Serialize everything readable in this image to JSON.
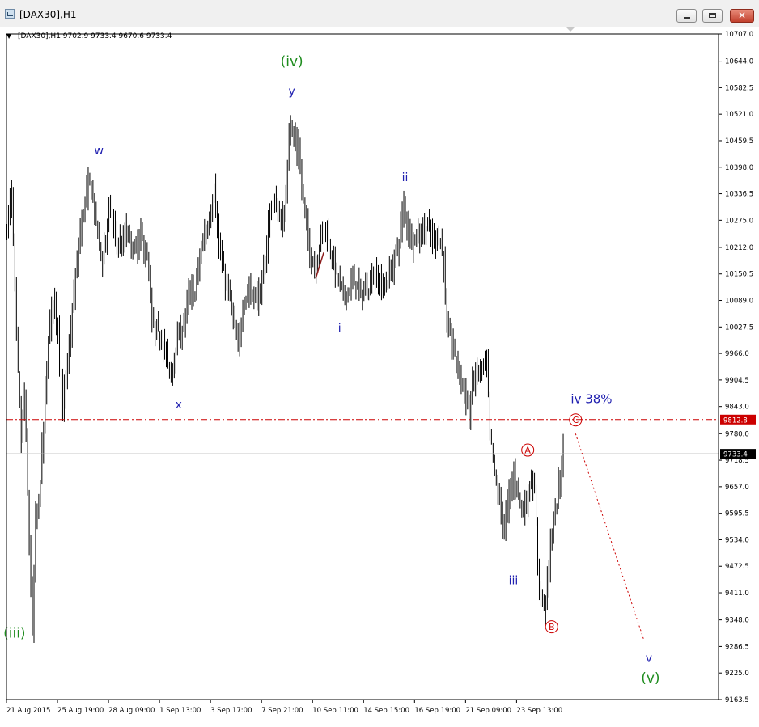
{
  "window": {
    "title": "[DAX30],H1",
    "minimize_glyph": "—",
    "maximize_glyph": "□",
    "close_glyph": "✕"
  },
  "chart_data": {
    "type": "candlestick-bar",
    "symbol_line": "[DAX30],H1  9702.9 9733.4 9670.6 9733.4",
    "header_arrow": "▼",
    "ylim": [
      9163.5,
      10707.0
    ],
    "y_ticks": [
      10707.0,
      10644.0,
      10582.5,
      10521.0,
      10459.5,
      10398.0,
      10336.5,
      10275.0,
      10212.0,
      10150.5,
      10089.0,
      10027.5,
      9966.0,
      9904.5,
      9843.0,
      9780.0,
      9718.5,
      9657.0,
      9595.5,
      9534.0,
      9472.5,
      9411.0,
      9348.0,
      9286.5,
      9225.0,
      9163.5
    ],
    "x_ticks": [
      {
        "label": "21 Aug 2015",
        "bar": 0
      },
      {
        "label": "25 Aug 19:00",
        "bar": 32
      },
      {
        "label": "28 Aug 09:00",
        "bar": 64
      },
      {
        "label": "1 Sep 13:00",
        "bar": 96
      },
      {
        "label": "3 Sep 17:00",
        "bar": 128
      },
      {
        "label": "7 Sep 21:00",
        "bar": 160
      },
      {
        "label": "10 Sep 11:00",
        "bar": 192
      },
      {
        "label": "14 Sep 15:00",
        "bar": 224
      },
      {
        "label": "16 Sep 19:00",
        "bar": 256
      },
      {
        "label": "21 Sep 09:00",
        "bar": 288
      },
      {
        "label": "23 Sep 13:00",
        "bar": 320
      }
    ],
    "price_key": [
      [
        0,
        10260
      ],
      [
        3,
        10340
      ],
      [
        6,
        10000
      ],
      [
        9,
        9760
      ],
      [
        11,
        9880
      ],
      [
        14,
        9520
      ],
      [
        16,
        9320
      ],
      [
        18,
        9580
      ],
      [
        20,
        9620
      ],
      [
        23,
        9800
      ],
      [
        26,
        10000
      ],
      [
        29,
        10100
      ],
      [
        32,
        10020
      ],
      [
        35,
        9830
      ],
      [
        38,
        9940
      ],
      [
        42,
        10100
      ],
      [
        46,
        10250
      ],
      [
        48,
        10300
      ],
      [
        52,
        10370
      ],
      [
        56,
        10270
      ],
      [
        60,
        10180
      ],
      [
        64,
        10300
      ],
      [
        68,
        10240
      ],
      [
        72,
        10210
      ],
      [
        75,
        10250
      ],
      [
        80,
        10200
      ],
      [
        84,
        10240
      ],
      [
        87,
        10200
      ],
      [
        89,
        10150
      ],
      [
        91,
        10030
      ],
      [
        94,
        10020
      ],
      [
        97,
        10000
      ],
      [
        100,
        9960
      ],
      [
        103,
        9910
      ],
      [
        106,
        9990
      ],
      [
        110,
        10020
      ],
      [
        114,
        10100
      ],
      [
        118,
        10110
      ],
      [
        121,
        10190
      ],
      [
        124,
        10240
      ],
      [
        127,
        10270
      ],
      [
        130,
        10360
      ],
      [
        133,
        10210
      ],
      [
        136,
        10150
      ],
      [
        139,
        10110
      ],
      [
        142,
        10050
      ],
      [
        145,
        9970
      ],
      [
        148,
        10080
      ],
      [
        151,
        10110
      ],
      [
        155,
        10100
      ],
      [
        159,
        10100
      ],
      [
        162,
        10180
      ],
      [
        165,
        10300
      ],
      [
        168,
        10320
      ],
      [
        171,
        10280
      ],
      [
        174,
        10270
      ],
      [
        177,
        10500
      ],
      [
        180,
        10460
      ],
      [
        183,
        10430
      ],
      [
        185,
        10350
      ],
      [
        188,
        10260
      ],
      [
        191,
        10180
      ],
      [
        194,
        10170
      ],
      [
        197,
        10240
      ],
      [
        200,
        10260
      ],
      [
        203,
        10210
      ],
      [
        206,
        10160
      ],
      [
        208,
        10140
      ],
      [
        211,
        10100
      ],
      [
        214,
        10110
      ],
      [
        218,
        10140
      ],
      [
        222,
        10100
      ],
      [
        226,
        10120
      ],
      [
        230,
        10150
      ],
      [
        234,
        10130
      ],
      [
        237,
        10120
      ],
      [
        240,
        10150
      ],
      [
        243,
        10180
      ],
      [
        246,
        10230
      ],
      [
        249,
        10310
      ],
      [
        252,
        10250
      ],
      [
        255,
        10230
      ],
      [
        258,
        10240
      ],
      [
        261,
        10250
      ],
      [
        264,
        10260
      ],
      [
        267,
        10230
      ],
      [
        271,
        10240
      ],
      [
        274,
        10180
      ],
      [
        276,
        10020
      ],
      [
        278,
        10010
      ],
      [
        281,
        9960
      ],
      [
        284,
        9920
      ],
      [
        287,
        9880
      ],
      [
        290,
        9820
      ],
      [
        292,
        9900
      ],
      [
        295,
        9920
      ],
      [
        298,
        9930
      ],
      [
        301,
        9940
      ],
      [
        303,
        9780
      ],
      [
        306,
        9690
      ],
      [
        309,
        9620
      ],
      [
        312,
        9560
      ],
      [
        315,
        9640
      ],
      [
        318,
        9680
      ],
      [
        321,
        9650
      ],
      [
        323,
        9600
      ],
      [
        326,
        9620
      ],
      [
        329,
        9680
      ],
      [
        331,
        9630
      ],
      [
        334,
        9420
      ],
      [
        337,
        9380
      ],
      [
        339,
        9430
      ],
      [
        341,
        9520
      ],
      [
        344,
        9600
      ],
      [
        347,
        9680
      ],
      [
        349,
        9733
      ]
    ],
    "horizontal_lines": [
      {
        "price": 9812.8,
        "label": "9812.8",
        "color": "#cc0000",
        "style": "dash-dot"
      },
      {
        "price": 9733.4,
        "label": "9733.4",
        "color": "#b4b4b4",
        "style": "solid"
      }
    ],
    "projection_line": {
      "from": [
        357,
        9780
      ],
      "to": [
        400,
        9300
      ],
      "color": "#cc0000",
      "style": "dotted"
    },
    "small_trendline": {
      "from": [
        194,
        10140
      ],
      "to": [
        199,
        10200
      ],
      "color": "#8b1a1a"
    },
    "annotations": [
      {
        "text": "(iv)",
        "bar": 179,
        "price": 10644,
        "color": "#1e8c1e",
        "kind": "text",
        "size": 17
      },
      {
        "text": "y",
        "bar": 179,
        "price": 10575,
        "color": "#2020b0",
        "kind": "text",
        "size": 14
      },
      {
        "text": "w",
        "bar": 58,
        "price": 10437,
        "color": "#2020b0",
        "kind": "text",
        "size": 14
      },
      {
        "text": "ii",
        "bar": 250,
        "price": 10375,
        "color": "#2020b0",
        "kind": "text",
        "size": 14
      },
      {
        "text": "i",
        "bar": 209,
        "price": 10025,
        "color": "#2020b0",
        "kind": "text",
        "size": 14
      },
      {
        "text": "x",
        "bar": 108,
        "price": 9848,
        "color": "#2020b0",
        "kind": "text",
        "size": 14
      },
      {
        "text": "iv 38%",
        "bar": 367,
        "price": 9861,
        "color": "#2020b0",
        "kind": "text",
        "size": 15
      },
      {
        "text": "C",
        "bar": 357,
        "price": 9812,
        "color": "#cc0000",
        "kind": "circled",
        "size": 11
      },
      {
        "text": "A",
        "bar": 327,
        "price": 9742,
        "color": "#cc0000",
        "kind": "circled",
        "size": 11
      },
      {
        "text": "iii",
        "bar": 318,
        "price": 9440,
        "color": "#2020b0",
        "kind": "text",
        "size": 14
      },
      {
        "text": "B",
        "bar": 342,
        "price": 9332,
        "color": "#cc0000",
        "kind": "circled",
        "size": 11
      },
      {
        "text": "(iii)",
        "bar": 5,
        "price": 9318,
        "color": "#1e8c1e",
        "kind": "text",
        "size": 17
      },
      {
        "text": "v",
        "bar": 403,
        "price": 9260,
        "color": "#2020b0",
        "kind": "text",
        "size": 14
      },
      {
        "text": "(v)",
        "bar": 404,
        "price": 9214,
        "color": "#1e8c1e",
        "kind": "text",
        "size": 17
      }
    ],
    "colors": {
      "bars": "#000000",
      "background": "#ffffff",
      "axis": "#000000",
      "tag_bg": "#000000",
      "tag_fg": "#ffffff"
    }
  }
}
